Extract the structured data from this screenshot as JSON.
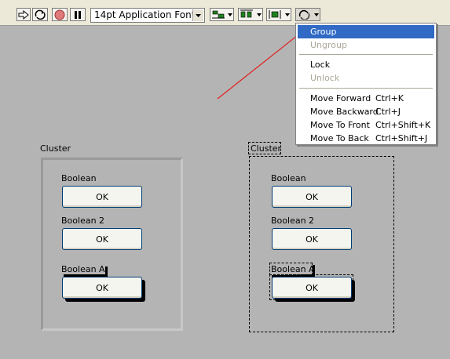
{
  "toolbar": {
    "font_select": "14pt Application Font",
    "icons": [
      "run-arrow-icon",
      "run-continuously-icon",
      "abort-stop-icon",
      "pause-icon",
      "align-objects-icon",
      "distribute-objects-icon",
      "resize-objects-icon",
      "reorder-icon"
    ]
  },
  "menu": {
    "items": [
      {
        "label": "Group",
        "shortcut": "",
        "state": "selected"
      },
      {
        "label": "Ungroup",
        "shortcut": "",
        "state": "disabled"
      },
      {
        "label": "Lock",
        "shortcut": "",
        "state": "enabled"
      },
      {
        "label": "Unlock",
        "shortcut": "",
        "state": "disabled"
      },
      {
        "label": "Move Forward",
        "shortcut": "Ctrl+K",
        "state": "enabled"
      },
      {
        "label": "Move Backward",
        "shortcut": "Ctrl+J",
        "state": "enabled"
      },
      {
        "label": "Move To Front",
        "shortcut": "Ctrl+Shift+K",
        "state": "enabled"
      },
      {
        "label": "Move To Back",
        "shortcut": "Ctrl+Shift+J",
        "state": "enabled"
      }
    ]
  },
  "cluster_left": {
    "title": "Cluster",
    "controls": [
      {
        "label": "Boolean",
        "button": "OK"
      },
      {
        "label": "Boolean 2",
        "button": "OK"
      },
      {
        "label": "Boolean A",
        "button": "OK"
      }
    ]
  },
  "cluster_right": {
    "title": "Cluster",
    "controls": [
      {
        "label": "Boolean",
        "button": "OK"
      },
      {
        "label": "Boolean 2",
        "button": "OK"
      },
      {
        "label": "Boolean A",
        "button": "OK"
      }
    ]
  },
  "colors": {
    "canvas": "#b4b4b4",
    "toolbar": "#ece9d8",
    "menu_highlight": "#316ac5",
    "annotation_arrow": "#e02020",
    "abort_red": "#e07a7a"
  }
}
